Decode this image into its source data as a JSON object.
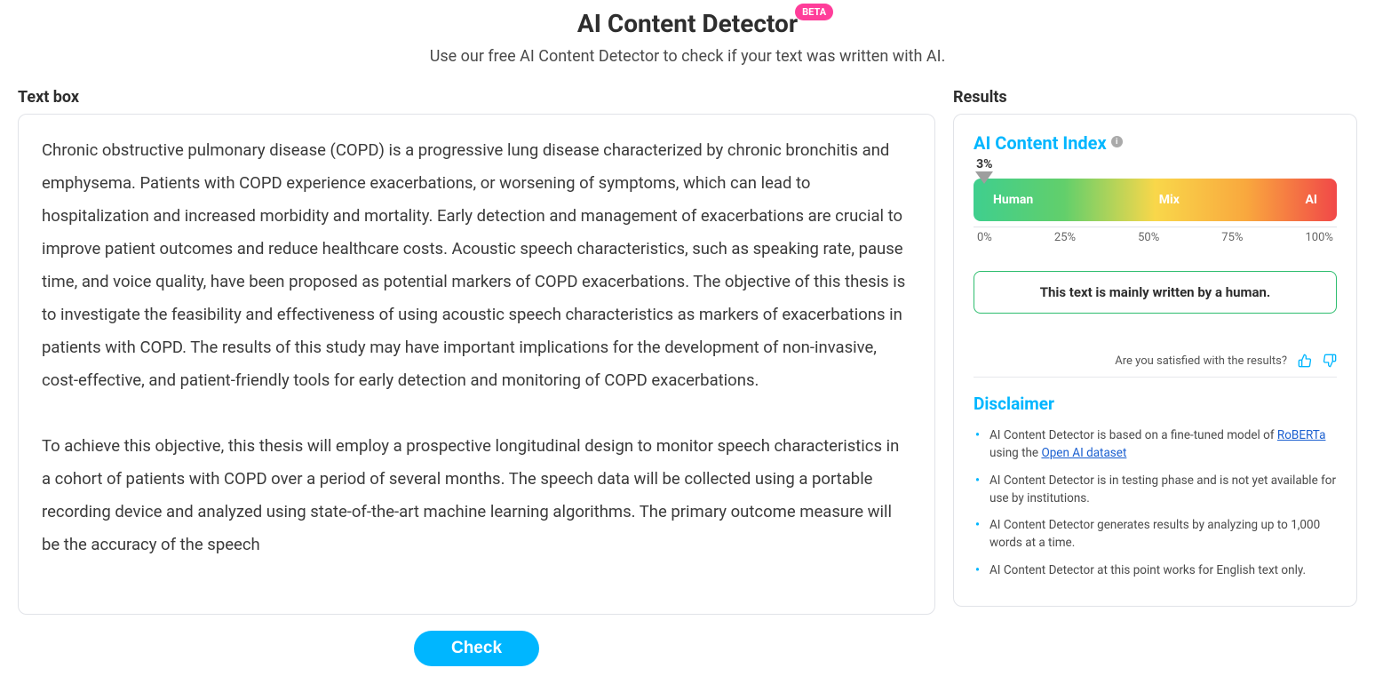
{
  "header": {
    "title": "AI Content Detector",
    "badge": "BETA",
    "subtitle": "Use our free AI Content Detector to check if your text was written with AI."
  },
  "left": {
    "label": "Text box",
    "content": "Chronic obstructive pulmonary disease (COPD) is a progressive lung disease characterized by chronic bronchitis and emphysema. Patients with COPD experience exacerbations, or worsening of symptoms, which can lead to hospitalization and increased morbidity and mortality. Early detection and management of exacerbations are crucial to improve patient outcomes and reduce healthcare costs. Acoustic speech characteristics, such as speaking rate, pause time, and voice quality, have been proposed as potential markers of COPD exacerbations. The objective of this thesis is to investigate the feasibility and effectiveness of using acoustic speech characteristics as markers of exacerbations in patients with COPD. The results of this study may have important implications for the development of non-invasive, cost-effective, and patient-friendly tools for early detection and monitoring of COPD exacerbations.\n\nTo achieve this objective, this thesis will employ a prospective longitudinal design to monitor speech characteristics in a cohort of patients with COPD over a period of several months. The speech data will be collected using a portable recording device and analyzed using state-of-the-art machine learning algorithms. The primary outcome measure will be the accuracy of the speech",
    "check_button": "Check"
  },
  "right": {
    "label": "Results",
    "index_title": "AI Content Index",
    "pointer_label": "3%",
    "pointer_percent": 3,
    "bar_labels": {
      "left": "Human",
      "mid": "Mix",
      "right": "AI"
    },
    "ticks": [
      "0%",
      "25%",
      "50%",
      "75%",
      "100%"
    ],
    "verdict": "This text is mainly written by a human.",
    "feedback_prompt": "Are you satisfied with the results?",
    "disclaimer_title": "Disclaimer",
    "disclaimer": {
      "item1_pre": "AI Content Detector is based on a fine-tuned model of ",
      "item1_link1": "RoBERTa",
      "item1_mid": " using the ",
      "item1_link2": "Open AI dataset",
      "item2": "AI Content Detector is in testing phase and is not yet available for use by institutions.",
      "item3": "AI Content Detector generates results by analyzing up to 1,000 words at a time.",
      "item4": "AI Content Detector at this point works for English text only."
    }
  }
}
